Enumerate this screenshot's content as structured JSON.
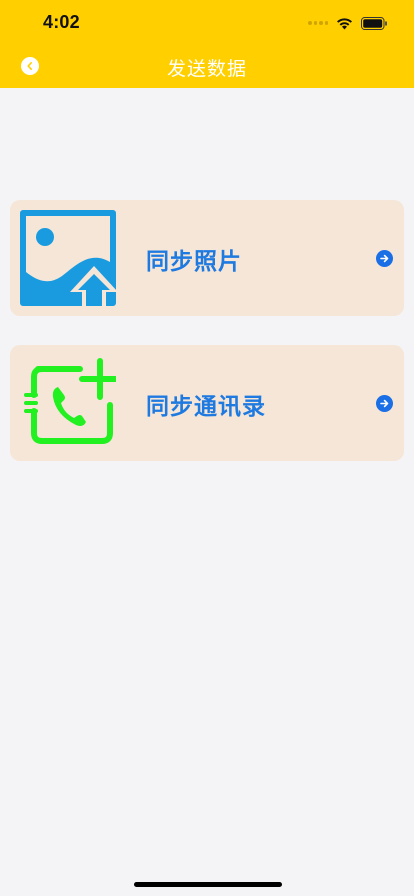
{
  "status_bar": {
    "time": "4:02"
  },
  "nav": {
    "title": "发送数据",
    "back_icon": "back-chevron-icon"
  },
  "cards": [
    {
      "label": "同步照片",
      "icon": "photo-upload-icon",
      "arrow_icon": "arrow-right-icon"
    },
    {
      "label": "同步通讯录",
      "icon": "contact-sync-icon",
      "arrow_icon": "arrow-right-icon"
    }
  ],
  "colors": {
    "header": "#ffcf00",
    "background": "#f4f4f6",
    "card": "#f5e6d7",
    "label": "#1e7ae0",
    "photo_icon": "#1a9be0",
    "contact_icon": "#22f021"
  }
}
